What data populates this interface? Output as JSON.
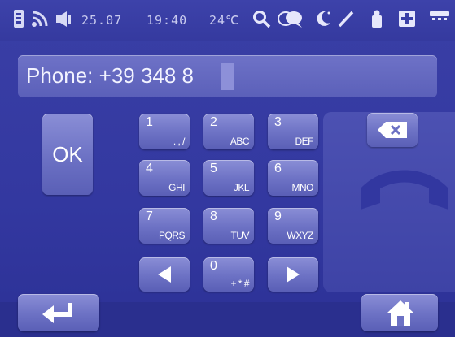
{
  "status_bar": {
    "date": "25.07",
    "time": "19:40",
    "temperature": "24℃",
    "icons": [
      "phone-battery-icon",
      "wifi-signal-icon",
      "speaker-icon",
      "search-icon",
      "chat-icon",
      "night-mode-icon",
      "edit-icon",
      "microphone-icon",
      "plus-icon",
      "menu-icon"
    ]
  },
  "display": {
    "value": "Phone: +39 348 8"
  },
  "keypad": {
    "ok_label": "OK",
    "keys": [
      {
        "num": "1",
        "letters": ". , /"
      },
      {
        "num": "2",
        "letters": "ABC"
      },
      {
        "num": "3",
        "letters": "DEF"
      },
      {
        "num": "4",
        "letters": "GHI"
      },
      {
        "num": "5",
        "letters": "JKL"
      },
      {
        "num": "6",
        "letters": "MNO"
      },
      {
        "num": "7",
        "letters": "PQRS"
      },
      {
        "num": "8",
        "letters": "TUV"
      },
      {
        "num": "9",
        "letters": "WXYZ"
      },
      {
        "num": "0",
        "letters": "+ * #"
      }
    ],
    "left_arrow_icon": "left-arrow-icon",
    "right_arrow_icon": "right-arrow-icon",
    "backspace_icon": "backspace-icon",
    "call_icon": "phone-handset-icon"
  },
  "bottom_bar": {
    "back_icon": "return-icon",
    "home_icon": "home-icon"
  },
  "colors": {
    "background": "#3338a0",
    "key": "#6c71c4",
    "text": "#ffffff"
  }
}
